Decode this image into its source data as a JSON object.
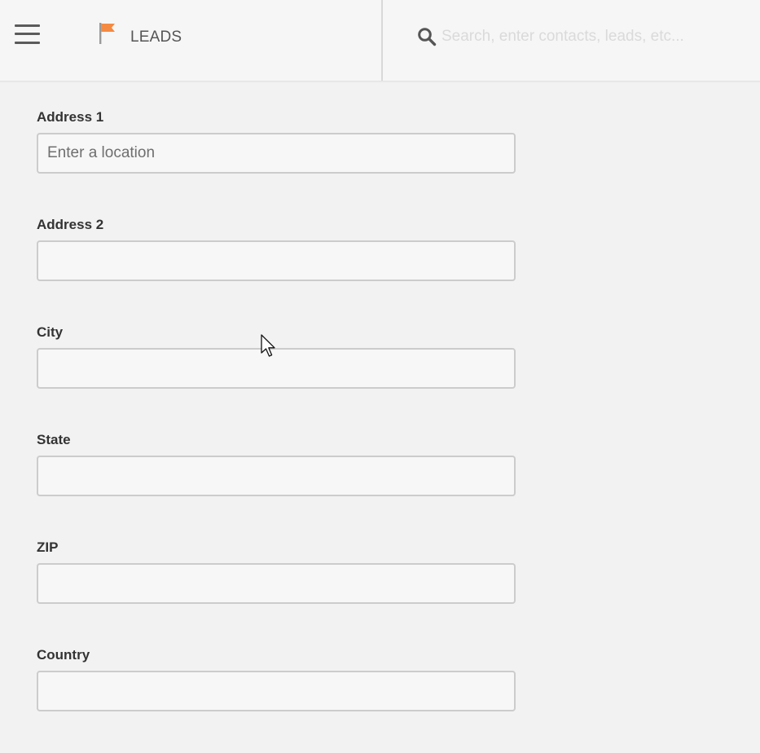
{
  "header": {
    "module_title": "LEADS",
    "search": {
      "placeholder": "Search, enter contacts, leads, etc...",
      "value": ""
    },
    "flag_color": "#f58a42"
  },
  "icons": {
    "menu": "hamburger-menu-icon",
    "module": "flag-icon",
    "search": "search-icon"
  },
  "form": {
    "fields": [
      {
        "label": "Address 1",
        "placeholder": "Enter a location",
        "value": ""
      },
      {
        "label": "Address 2",
        "placeholder": "",
        "value": ""
      },
      {
        "label": "City",
        "placeholder": "",
        "value": ""
      },
      {
        "label": "State",
        "placeholder": "",
        "value": ""
      },
      {
        "label": "ZIP",
        "placeholder": "",
        "value": ""
      },
      {
        "label": "Country",
        "placeholder": "",
        "value": ""
      }
    ]
  }
}
